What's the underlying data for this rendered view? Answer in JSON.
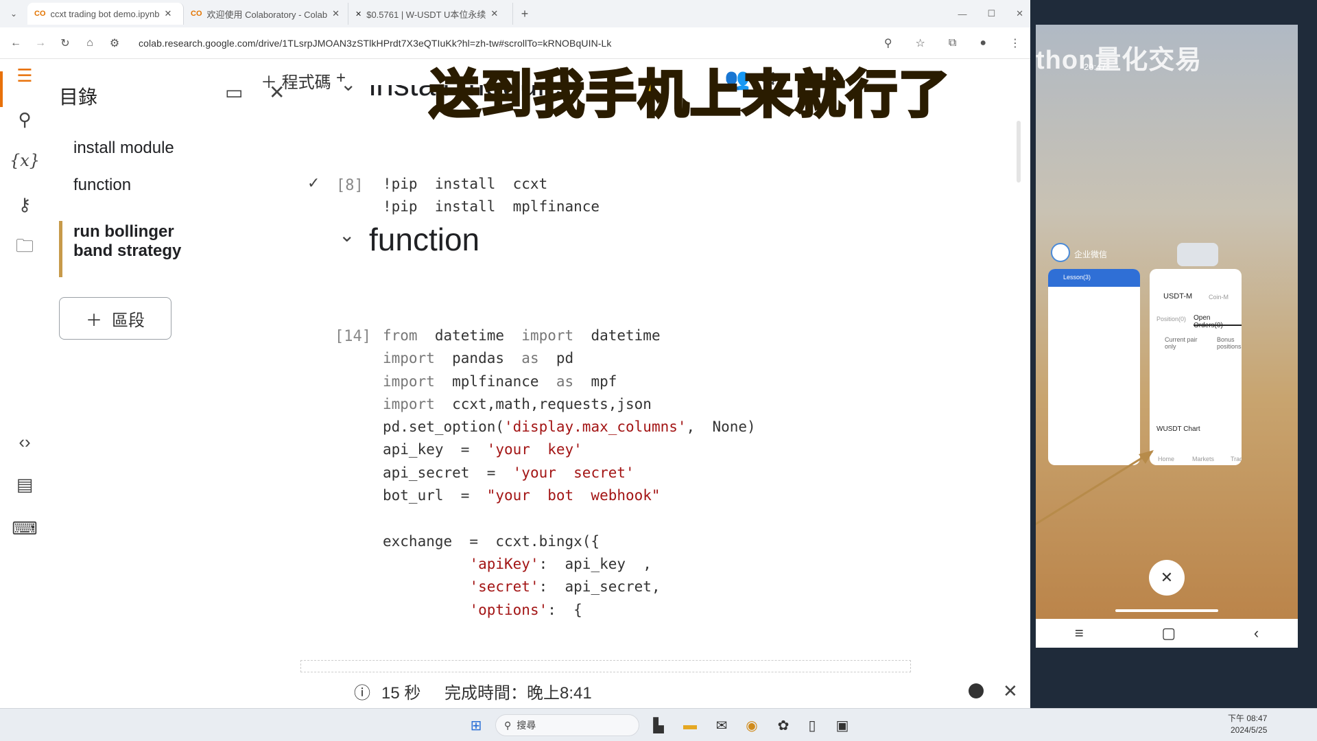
{
  "browser": {
    "tabs": [
      {
        "label": "ccxt trading bot demo.ipynb",
        "icon": "colab-icon",
        "active": true
      },
      {
        "label": "欢迎使用 Colaboratory - Colab",
        "icon": "colab-icon",
        "active": false
      },
      {
        "label": "$0.5761 | W-USDT U本位永续",
        "icon": "exchange-icon",
        "active": false
      }
    ],
    "url": "colab.research.google.com/drive/1TLsrpJMOAN3zSTlkHPrdt7X3eQTIuKk?hl=zh-tw#scrollTo=kRNOBqUIN-Lk"
  },
  "toc": {
    "title": "目錄",
    "items": [
      "install module",
      "function",
      "run bollinger band strategy"
    ],
    "add_section_label": "區段"
  },
  "notebook": {
    "toolbar": {
      "code": "程式碼",
      "text": "+"
    },
    "section_install": "install module",
    "cell1": {
      "count": "[8]",
      "lines": [
        "!pip  install  ccxt",
        "!pip  install  mplfinance"
      ]
    },
    "section_function": "function",
    "cell2": {
      "count": "[14]"
    }
  },
  "status": {
    "duration": "15 秒",
    "done": "完成時間：晚上8:41"
  },
  "caption": "送到我手机上来就行了",
  "phone": {
    "time": "20:47",
    "brand_overlay": "thon量化交易",
    "app1_title": "企业微信",
    "card1_header": "Lesson(3)",
    "card2": {
      "tab1": "USDT-M",
      "tab2": "Coin-M",
      "orders_tab1": "Position(0)",
      "orders_tab2": "Open Orders(0)",
      "col1": "Current pair only",
      "col2": "Bonus positions",
      "chart_label": "WUSDT Chart",
      "nav": [
        "Home",
        "Markets",
        "Trade"
      ]
    }
  },
  "taskbar": {
    "search": "搜尋",
    "time": "下午 08:47",
    "date": "2024/5/25"
  },
  "colors": {
    "accent": "#e8710a",
    "caption": "#f5c20f"
  }
}
